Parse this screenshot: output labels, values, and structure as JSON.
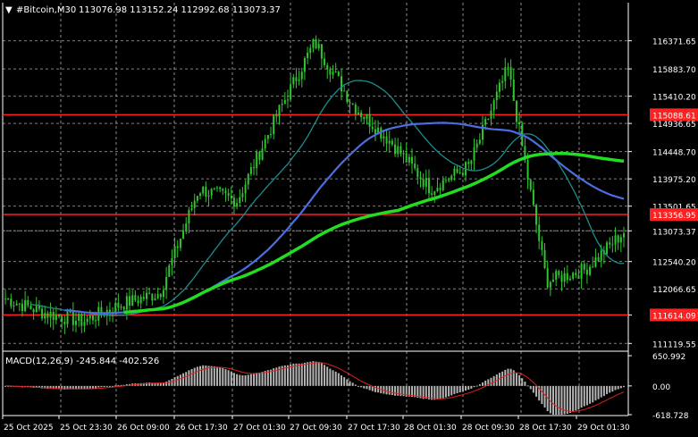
{
  "header": {
    "arrow": "▼",
    "symbol": "#Bitcoin,M30",
    "ohlc": "113076.98 113152.24 112992.68 113073.37"
  },
  "colors": {
    "background": "#000000",
    "grid": "#ffffff",
    "candle": "#2ec52e",
    "ma_fast": "#1e8c8c",
    "ma_mid": "#4a6fe0",
    "ma_slow": "#22dd22",
    "level_line": "#ff2020",
    "macd_hist": "#b4b4b4",
    "macd_signal": "#e02020"
  },
  "price_axis": {
    "ticks": [
      "116371.65",
      "115883.70",
      "115410.20",
      "114936.65",
      "114448.70",
      "113975.20",
      "113501.65",
      "113073.37",
      "112540.20",
      "112066.65",
      "111614.09",
      "111119.55"
    ]
  },
  "level_labels": [
    {
      "value": "115088.61"
    },
    {
      "value": "113356.95"
    },
    {
      "value": "113073.37"
    },
    {
      "value": "111614.09"
    }
  ],
  "macd": {
    "label": "MACD(12,26,9) -245.844 -402.526",
    "ticks": [
      "650.992",
      "0.00",
      "-618.728"
    ]
  },
  "time_axis": {
    "labels": [
      "25 Oct 2025",
      "25 Oct 23:30",
      "26 Oct 09:00",
      "26 Oct 17:30",
      "27 Oct 01:30",
      "27 Oct 09:30",
      "27 Oct 17:30",
      "28 Oct 01:30",
      "28 Oct 09:30",
      "28 Oct 17:30",
      "29 Oct 01:30"
    ]
  },
  "chart_data": {
    "type": "line",
    "title": "#Bitcoin,M30",
    "ylim": [
      111000,
      116800
    ],
    "horizontal_levels": [
      115088.61,
      113356.95,
      111614.09
    ],
    "current_price": 113073.37,
    "price_anchor": {
      "x_labels": [
        "25 Oct 2025",
        "25 Oct 23:30",
        "26 Oct 09:00",
        "26 Oct 17:30",
        "27 Oct 01:30",
        "27 Oct 09:30",
        "27 Oct 17:30",
        "28 Oct 01:30",
        "28 Oct 09:30",
        "28 Oct 17:30",
        "29 Oct 01:30",
        ""
      ],
      "close": [
        111900,
        111650,
        111500,
        111800,
        112000,
        113800,
        113600,
        115050,
        116350,
        115250,
        114600,
        113800,
        114200,
        115900,
        112200,
        112400,
        113050
      ]
    },
    "series": [
      {
        "name": "MACD",
        "values": [
          -245.844
        ]
      },
      {
        "name": "Signal",
        "values": [
          -402.526
        ]
      }
    ]
  }
}
